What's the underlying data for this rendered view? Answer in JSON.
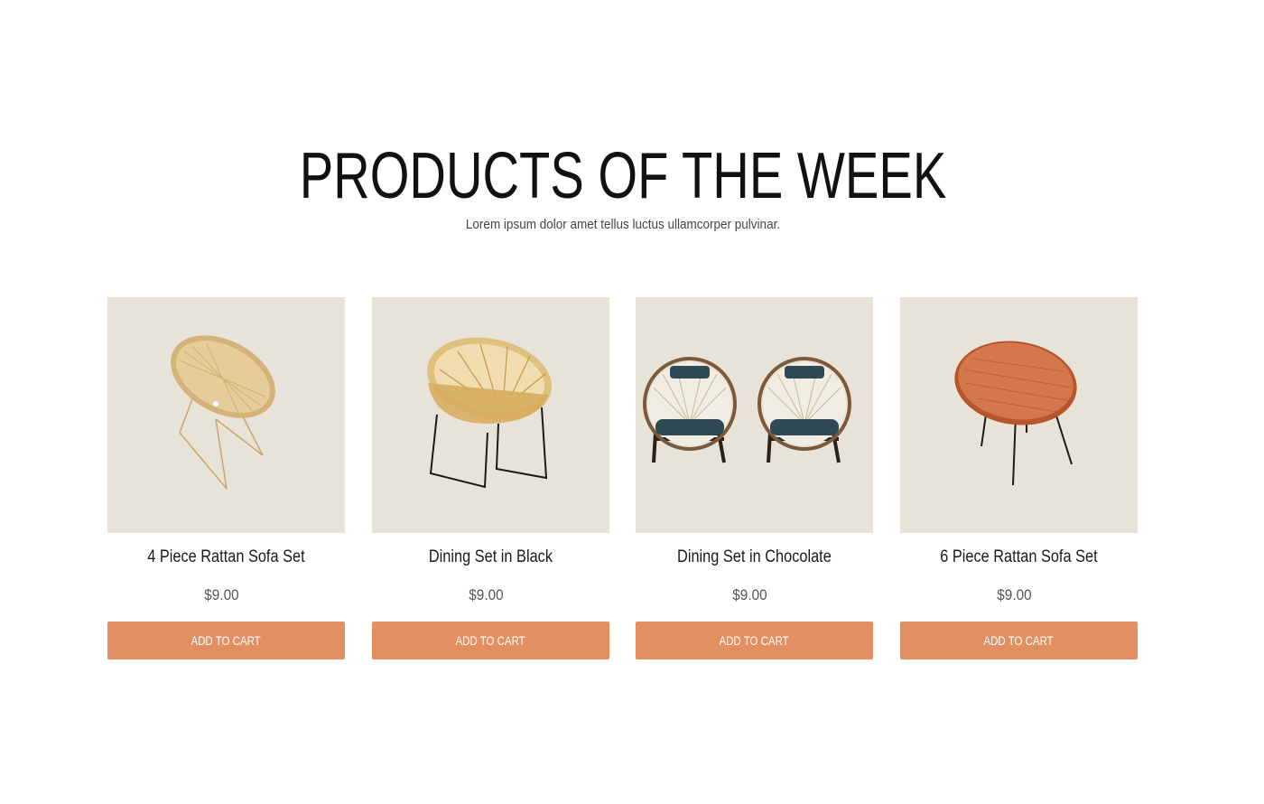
{
  "section": {
    "title": "PRODUCTS OF THE WEEK",
    "subtitle": "Lorem ipsum dolor amet tellus luctus ullamcorper pulvinar."
  },
  "products": [
    {
      "name": "4 Piece Rattan Sofa Set",
      "price": "$9.00",
      "button": "ADD TO CART",
      "image": "rattan-cone-chair-icon"
    },
    {
      "name": "Dining Set in Black",
      "price": "$9.00",
      "button": "ADD TO CART",
      "image": "rattan-hoop-chair-icon"
    },
    {
      "name": "Dining Set in Chocolate",
      "price": "$9.00",
      "button": "ADD TO CART",
      "image": "hoop-lounge-chairs-pair-icon"
    },
    {
      "name": "6 Piece Rattan Sofa Set",
      "price": "$9.00",
      "button": "ADD TO CART",
      "image": "orange-rattan-bowl-chair-icon"
    }
  ],
  "colors": {
    "accent": "#e38f62",
    "thumb_bg": "#e8e3d9",
    "title": "#111111"
  }
}
